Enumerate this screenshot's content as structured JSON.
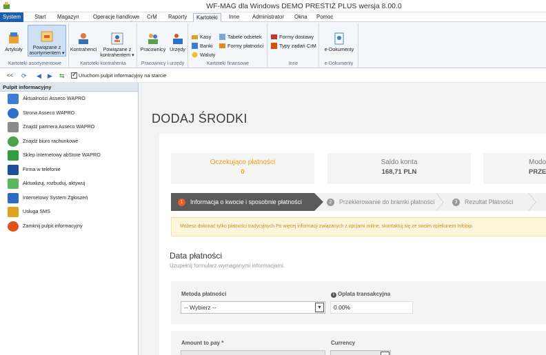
{
  "window": {
    "title": "WF-MAG dla Windows DEMO PRESTIŻ PLUS  wersja 8.00.0"
  },
  "menu": {
    "tabs": [
      "System",
      "Start",
      "Magazyn",
      "Operacje handlowe",
      "CrM",
      "Raporty",
      "Kartoteki",
      "Inne",
      "Administrator",
      "Okna",
      "Pomoc"
    ]
  },
  "ribbon": {
    "groups": {
      "asortyment": "Kartoteki asortymentowe",
      "kontrahent": "Kartoteki kontrahenta",
      "pracownicy": "Pracownicy i urzędy",
      "finansowe": "Kartoteki finansowe",
      "inne": "Inne",
      "edok": "e-Dokumenty"
    },
    "buttons": {
      "artykuly": "Artykuły",
      "powiazane_asort_1": "Powiązane z",
      "powiazane_asort_2": "asortymentem ▾",
      "kontrahenci": "Kontrahenci",
      "powiazane_kontr_1": "Powiązane z",
      "powiazane_kontr_2": "kontrahentem ▾",
      "pracownicy": "Pracownicy",
      "urzedy": "Urzędy",
      "kasy": "Kasy",
      "banki": "Banki",
      "waluty": "Waluty",
      "tabele_odsetek": "Tabele odsetek",
      "formy_platnosci": "Formy płatności",
      "formy_dostawy": "Formy dostawy",
      "typy_zadan": "Typy zadań CrM",
      "e_dokumenty": "e-Dokumenty"
    }
  },
  "quickbar": {
    "nav": [
      "<<",
      "⟳",
      "◀",
      "▶",
      "⇆"
    ],
    "checkbox_label": "Uruchom pulpit informacyjny na starcie"
  },
  "sidebar": {
    "header": "Pulpit informacyjny",
    "items": [
      {
        "label": "Aktualności Asseco WAPRO",
        "color": "#3b7dd8"
      },
      {
        "label": "Strona Asseco WAPRO",
        "color": "#2e6fc7"
      },
      {
        "label": "Znajdź partnera Asseco WAPRO",
        "color": "#8a8a8a"
      },
      {
        "label": "Znajdź biuro rachunkowe",
        "color": "#4aa34a"
      },
      {
        "label": "Sklep internetowy abStore WAPRO",
        "color": "#2f9e41"
      },
      {
        "label": "Firma w telefonie",
        "color": "#1d4f9c"
      },
      {
        "label": "Aktualizuj, rozbuduj, aktywuj",
        "color": "#5cb85c"
      },
      {
        "label": "Internetowy System Zgłoszeń",
        "color": "#2a6cc4"
      },
      {
        "label": "Usługa SMS",
        "color": "#e0a020"
      },
      {
        "label": "Zamknij pulpit informacyjny",
        "color": "#e0521b"
      }
    ]
  },
  "content": {
    "title": "DODAJ ŚRODKI",
    "stats": [
      {
        "label": "Oczekująco płatności",
        "value": "0"
      },
      {
        "label": "Saldo konta",
        "value": "168,71 PLN"
      },
      {
        "label": "Modo",
        "value": "PRZE"
      }
    ],
    "steps": [
      {
        "num": "1",
        "label": "Informacja o kwocie i sposobnie płatności"
      },
      {
        "num": "2",
        "label": "Przekierowanie do bramki płatności"
      },
      {
        "num": "3",
        "label": "Rezultat Płatności"
      }
    ],
    "alert": "Możesz dokonać tylko płatności tradycyjnych Po więcej informacji związanych z opcjami online, skontaktuj się ze swoim opiekunem Infobip.",
    "section": {
      "title": "Data płatności",
      "subtitle": "Uzupełnij formularz wymaganymi informacjami."
    },
    "form": {
      "metoda_label": "Metoda płatności",
      "metoda_value": "-- Wybierz --",
      "oplata_label": "Oplata transakcyjna",
      "oplata_value": "0.00%",
      "amount_label": "Amount to pay *",
      "currency_label": "Currency"
    }
  }
}
